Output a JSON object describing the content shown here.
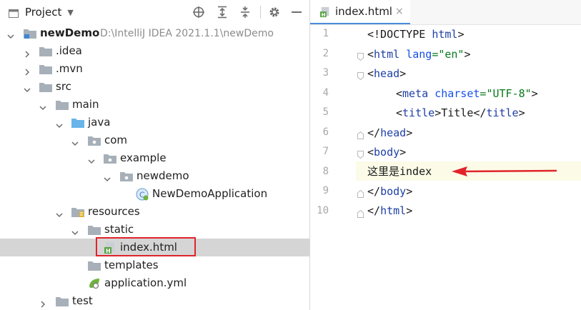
{
  "project_pane": {
    "title": "Project",
    "tree": [
      {
        "label": "newDemo",
        "path": "D:\\IntelliJ IDEA 2021.1.1\\newDemo"
      },
      {
        "label": ".idea"
      },
      {
        "label": ".mvn"
      },
      {
        "label": "src"
      },
      {
        "label": "main"
      },
      {
        "label": "java"
      },
      {
        "label": "com"
      },
      {
        "label": "example"
      },
      {
        "label": "newdemo"
      },
      {
        "label": "NewDemoApplication"
      },
      {
        "label": "resources"
      },
      {
        "label": "static"
      },
      {
        "label": "index.html"
      },
      {
        "label": "templates"
      },
      {
        "label": "application.yml"
      },
      {
        "label": "test"
      }
    ]
  },
  "editor": {
    "tab": {
      "label": "index.html",
      "close": "×"
    },
    "line_numbers": [
      "1",
      "2",
      "3",
      "4",
      "5",
      "6",
      "7",
      "8",
      "9",
      "10"
    ],
    "lines": [
      {
        "t1": "<!DOCTYPE ",
        "t2": "html",
        "t3": ">"
      },
      {
        "t1": "<",
        "t2": "html ",
        "t3": "lang",
        "t4": "=",
        "t5": "\"en\"",
        "t6": ">"
      },
      {
        "t1": "<",
        "t2": "head",
        "t3": ">"
      },
      {
        "t1": "<",
        "t2": "meta ",
        "t3": "charset",
        "t4": "=",
        "t5": "\"UTF-8\"",
        "t6": ">"
      },
      {
        "t1": "<",
        "t2": "title",
        "t3": ">Title</",
        "t4": "title",
        "t5": ">"
      },
      {
        "t1": "</",
        "t2": "head",
        "t3": ">"
      },
      {
        "t1": "<",
        "t2": "body",
        "t3": ">"
      },
      {
        "t1": "这里是index"
      },
      {
        "t1": "</",
        "t2": "body",
        "t3": ">"
      },
      {
        "t1": "</",
        "t2": "html",
        "t3": ">"
      }
    ]
  },
  "colors": {
    "highlight": "#e0242a",
    "selected_row": "#d5d5d5",
    "folder": "#a7b0b8",
    "source_folder": "#69b4e8"
  }
}
